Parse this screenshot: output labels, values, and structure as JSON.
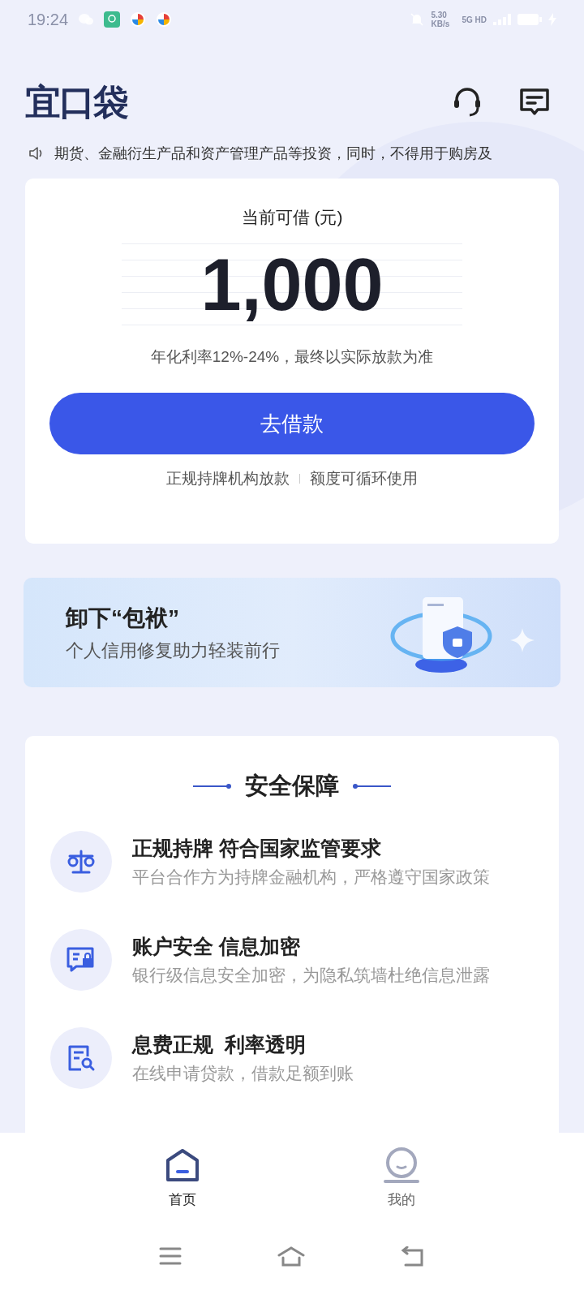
{
  "status_bar": {
    "time": "19:24",
    "speed": "5.30 KB/s",
    "network": "5G HD"
  },
  "header": {
    "logo": "宜口袋"
  },
  "notice": {
    "text": "期货、金融衍生产品和资产管理产品等投资，同时，不得用于购房及"
  },
  "loan_card": {
    "label": "当前可借 (元)",
    "amount": "1,000",
    "rate_note": "年化利率12%-24%，最终以实际放款为准",
    "button": "去借款",
    "features": [
      "正规持牌机构放款",
      "额度可循环使用"
    ]
  },
  "banner": {
    "title": "卸下“包袱”",
    "subtitle": "个人信用修复助力轻装前行"
  },
  "security": {
    "title": "安全保障",
    "items": [
      {
        "kind": "scale",
        "title": "正规持牌 符合国家监管要求",
        "desc": "平台合作方为持牌金融机构，严格遵守国家政策"
      },
      {
        "kind": "chat-lock",
        "title": "账户安全 信息加密",
        "desc": "银行级信息安全加密，为隐私筑墙杜绝信息泄露"
      },
      {
        "kind": "doc-search",
        "title": "息费正规  利率透明",
        "desc": "在线申请贷款，借款足额到账"
      }
    ]
  },
  "bottom_nav": [
    {
      "kind": "home",
      "label": "首页",
      "selected": true
    },
    {
      "kind": "profile",
      "label": "我的",
      "selected": false
    }
  ]
}
